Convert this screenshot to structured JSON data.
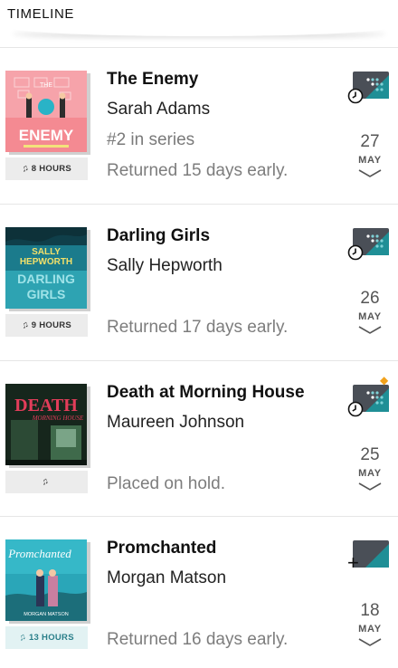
{
  "header": {
    "title": "TIMELINE"
  },
  "entries": [
    {
      "title": "The Enemy",
      "author": "Sarah Adams",
      "series": "#2 in series",
      "status": "Returned 15 days early.",
      "format_label": "8 HOURS",
      "day": "27",
      "month": "MAY",
      "cover_text": "ENEMY",
      "cover_top": "THE",
      "cover_colors": [
        "#f07b86",
        "#f7a7ae"
      ]
    },
    {
      "title": "Darling Girls",
      "author": "Sally Hepworth",
      "status": "Returned 17 days early.",
      "format_label": "9 HOURS",
      "day": "26",
      "month": "MAY",
      "cover_text_1": "SALLY",
      "cover_text_2": "HEPWORTH",
      "cover_text_3": "DARLING",
      "cover_text_4": "GIRLS"
    },
    {
      "title": "Death at Morning House",
      "author": "Maureen Johnson",
      "status": "Placed on hold.",
      "format_label": "",
      "day": "25",
      "month": "MAY",
      "cover_text_1": "DEATH",
      "cover_text_2": "MORNING HOUSE"
    },
    {
      "title": "Promchanted",
      "author": "Morgan Matson",
      "status": "Returned 16 days early.",
      "format_label": "13 HOURS",
      "day": "18",
      "month": "MAY",
      "cover_text_1": "Promchanted",
      "cover_text_2": "MORGAN MATSON"
    }
  ],
  "icons": {
    "library_app": "library-app-icon",
    "clock": "clock-icon",
    "plus": "plus-icon",
    "star": "star-icon",
    "chevron": "chevron-down-icon",
    "headphones": "headphones-icon"
  },
  "colors": {
    "library_dark": "#4a4f57",
    "library_teal": "#1f8f96",
    "star": "#f2a21b",
    "teal_badge_bg": "#e2f2f3",
    "teal_badge_text": "#2a7f8a"
  }
}
